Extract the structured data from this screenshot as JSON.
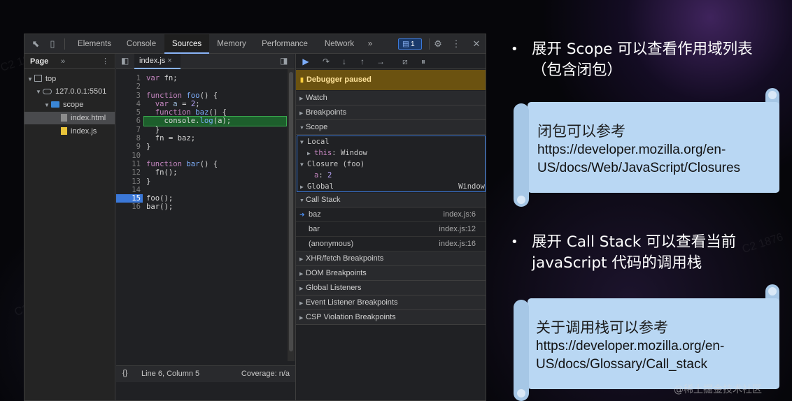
{
  "devtools": {
    "tabs": [
      "Elements",
      "Console",
      "Sources",
      "Memory",
      "Performance",
      "Network"
    ],
    "active_tab": "Sources",
    "more_tabs": "»",
    "message_count": "1",
    "navigator": {
      "tab": "Page",
      "more": "»",
      "tree": [
        "top",
        "127.0.0.1:5501",
        "scope",
        "index.html",
        "index.js"
      ]
    },
    "editor": {
      "file_tab": "index.js",
      "close": "×",
      "lines": [
        {
          "n": "1",
          "code": "var fn;"
        },
        {
          "n": "2",
          "code": ""
        },
        {
          "n": "3",
          "code": "function foo() {"
        },
        {
          "n": "4",
          "code": "  var a = 2;"
        },
        {
          "n": "5",
          "code": "  function baz() {"
        },
        {
          "n": "6",
          "code": "    console.log(a);"
        },
        {
          "n": "7",
          "code": "  }"
        },
        {
          "n": "8",
          "code": "  fn = baz;"
        },
        {
          "n": "9",
          "code": "}"
        },
        {
          "n": "10",
          "code": ""
        },
        {
          "n": "11",
          "code": "function bar() {"
        },
        {
          "n": "12",
          "code": "  fn();"
        },
        {
          "n": "13",
          "code": "}"
        },
        {
          "n": "14",
          "code": ""
        },
        {
          "n": "15",
          "code": "foo();"
        },
        {
          "n": "16",
          "code": "bar();"
        }
      ],
      "status": {
        "braces": "{}",
        "position": "Line 6, Column 5",
        "coverage": "Coverage: n/a"
      }
    },
    "debugger": {
      "paused": "Debugger paused",
      "sections": {
        "watch": "Watch",
        "breakpoints": "Breakpoints",
        "scope": "Scope",
        "call_stack": "Call Stack",
        "xhr": "XHR/fetch Breakpoints",
        "dom": "DOM Breakpoints",
        "global_listeners": "Global Listeners",
        "event_listener": "Event Listener Breakpoints",
        "csp": "CSP Violation Breakpoints"
      },
      "scope": {
        "local": "Local",
        "this_key": "this",
        "this_val": "Window",
        "closure": "Closure (foo)",
        "a_key": "a",
        "a_val": "2",
        "global": "Global",
        "global_val": "Window"
      },
      "call_stack": [
        {
          "name": "baz",
          "loc": "index.js:6"
        },
        {
          "name": "bar",
          "loc": "index.js:12"
        },
        {
          "name": "(anonymous)",
          "loc": "index.js:16"
        }
      ]
    }
  },
  "slide": {
    "bullet1": "展开 Scope 可以查看作用域列表（包含闭包）",
    "card1_title": "闭包可以参考",
    "card1_url": "https://developer.mozilla.org/en-US/docs/Web/JavaScript/Closures",
    "bullet2": "展开 Call Stack 可以查看当前 javaScript 代码的调用栈",
    "card2_title": "关于调用栈可以参考",
    "card2_url": "https://developer.mozilla.org/en-US/docs/Glossary/Call_stack",
    "watermark": "@稀土掘金技术社区"
  },
  "colors": {
    "accent": "#3b78d8",
    "paused_bg": "#6b5210",
    "exec_line": "#1d5f2c",
    "card": "#b9d7f3"
  }
}
